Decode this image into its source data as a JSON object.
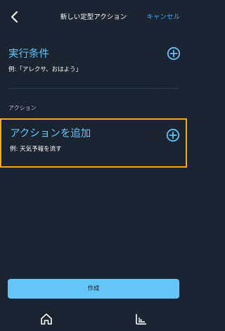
{
  "header": {
    "title": "新しい定型アクション",
    "cancel_label": "キャンセル",
    "back_icon": "chevron-left-icon"
  },
  "trigger": {
    "heading": "実行条件",
    "example": "例:「アレクサ、おはよう」",
    "add_icon": "plus-circle-icon"
  },
  "actions": {
    "caption": "アクション",
    "heading": "アクションを追加",
    "example": "例: 天気予報を流す",
    "add_icon": "plus-circle-icon",
    "highlight_color": "#f2a917"
  },
  "footer": {
    "create_label": "作成"
  },
  "tabbar": {
    "items": [
      "home-icon",
      "activity-bars-icon"
    ]
  },
  "colors": {
    "background": "#1b2431",
    "accent": "#62c4f8",
    "link": "#3fa9f5",
    "button": "#64c6f8"
  }
}
